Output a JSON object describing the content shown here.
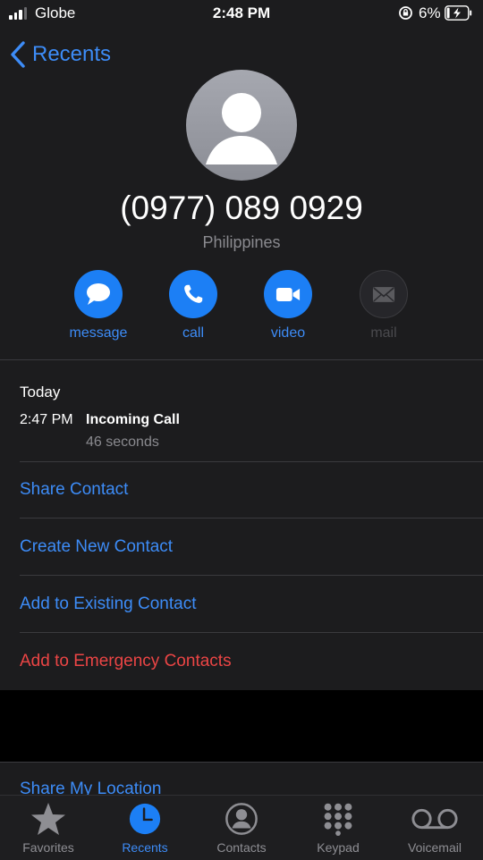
{
  "status_bar": {
    "carrier": "Globe",
    "time": "2:48 PM",
    "battery": "6%"
  },
  "nav": {
    "back_label": "Recents"
  },
  "contact": {
    "number": "(0977) 089 0929",
    "country": "Philippines"
  },
  "actions": [
    {
      "label": "message",
      "icon": "message-icon"
    },
    {
      "label": "call",
      "icon": "phone-icon"
    },
    {
      "label": "video",
      "icon": "video-icon"
    },
    {
      "label": "mail",
      "icon": "mail-icon",
      "disabled": true
    }
  ],
  "history": {
    "day": "Today",
    "time": "2:47 PM",
    "type": "Incoming Call",
    "duration": "46 seconds"
  },
  "options": {
    "share_contact": "Share Contact",
    "create_new": "Create New Contact",
    "add_existing": "Add to Existing Contact",
    "add_emergency": "Add to Emergency Contacts",
    "share_location": "Share My Location"
  },
  "tabs": [
    {
      "label": "Favorites",
      "icon": "star-icon"
    },
    {
      "label": "Recents",
      "icon": "clock-icon",
      "active": true
    },
    {
      "label": "Contacts",
      "icon": "person-circle-icon"
    },
    {
      "label": "Keypad",
      "icon": "keypad-icon"
    },
    {
      "label": "Voicemail",
      "icon": "voicemail-icon"
    }
  ],
  "colors": {
    "accent": "#3d8cf7",
    "button": "#1c7ff5",
    "destructive": "#eb4545",
    "background": "#1c1c1e"
  }
}
